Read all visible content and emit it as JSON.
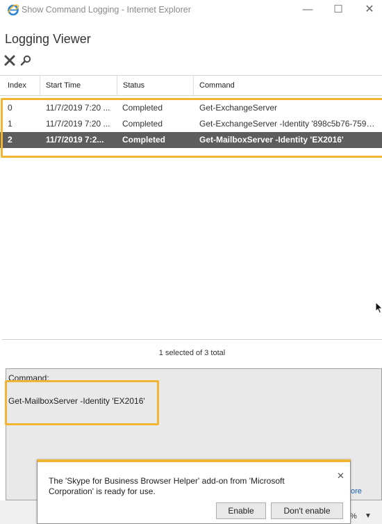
{
  "window": {
    "title": "Show Command Logging - Internet Explorer",
    "app_icon": "internet-explorer-icon",
    "controls": {
      "minimize": "—",
      "maximize": "☐",
      "close": "✕"
    }
  },
  "page": {
    "heading": "Logging Viewer",
    "toolbar": [
      {
        "name": "delete",
        "icon": "delete-x-icon"
      },
      {
        "name": "search",
        "icon": "search-icon"
      }
    ]
  },
  "grid": {
    "columns": [
      "Index",
      "Start Time",
      "Status",
      "Command"
    ],
    "rows": [
      {
        "index": "0",
        "start_time": "11/7/2019 7:20 ...",
        "status": "Completed",
        "command": "Get-ExchangeServer"
      },
      {
        "index": "1",
        "start_time": "11/7/2019 7:20 ...",
        "status": "Completed",
        "command": "Get-ExchangeServer -Identity '898c5b76-759a-..."
      },
      {
        "index": "2",
        "start_time": "11/7/2019 7:2...",
        "status": "Completed",
        "command": "Get-MailboxServer -Identity 'EX2016'"
      }
    ],
    "selected_row": 2
  },
  "status_bar": {
    "text": "1 selected of 3 total"
  },
  "detail": {
    "label": "Command:",
    "value": "Get-MailboxServer -Identity 'EX2016'"
  },
  "bottom": {
    "more_link": "ore",
    "zoom": "%"
  },
  "notification": {
    "message": "The 'Skype for Business Browser Helper' add-on from 'Microsoft Corporation' is ready for use.",
    "close": "✕",
    "enable_label": "Enable",
    "dont_enable_label": "Don't enable"
  },
  "colors": {
    "highlight": "#f2b533",
    "selected_row_bg": "#5d5d5d",
    "detail_bg": "#e9e9e9"
  }
}
